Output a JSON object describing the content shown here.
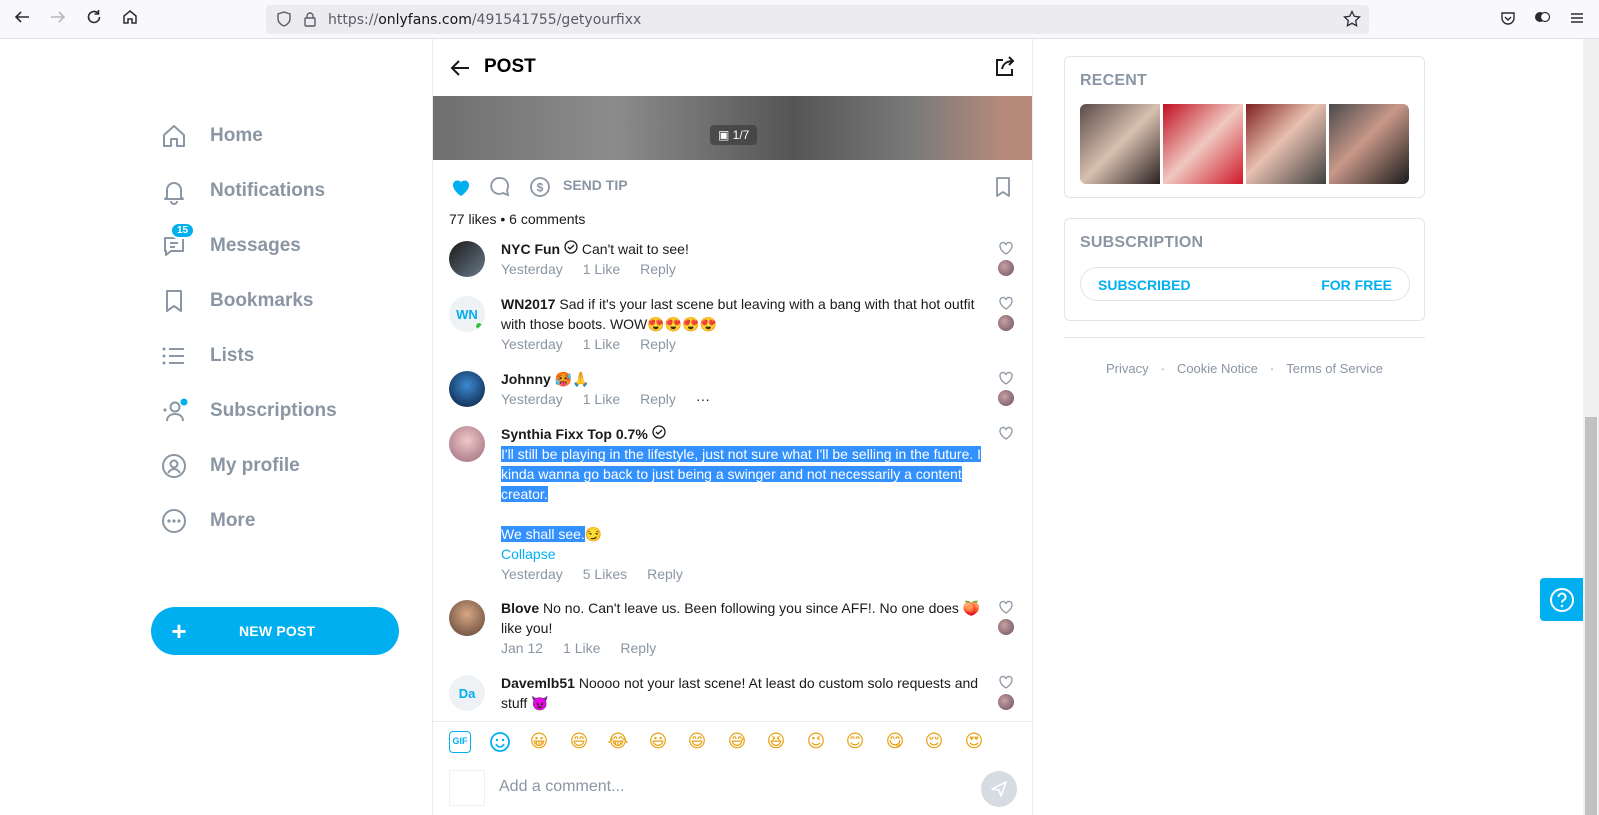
{
  "browser": {
    "url_prefix": "https://",
    "url_domain": "onlyfans.com",
    "url_path": "/491541755/getyourfixx"
  },
  "sidebar": {
    "items": [
      {
        "label": "Home",
        "icon": "home-icon"
      },
      {
        "label": "Notifications",
        "icon": "bell-icon"
      },
      {
        "label": "Messages",
        "icon": "message-icon",
        "badge": "15"
      },
      {
        "label": "Bookmarks",
        "icon": "bookmark-icon"
      },
      {
        "label": "Lists",
        "icon": "list-icon"
      },
      {
        "label": "Subscriptions",
        "icon": "subscriptions-icon"
      },
      {
        "label": "My profile",
        "icon": "profile-icon"
      },
      {
        "label": "More",
        "icon": "more-icon"
      }
    ],
    "new_post_label": "NEW POST"
  },
  "post": {
    "title": "POST",
    "image_counter": "1/7",
    "send_tip_label": "SEND TIP",
    "likes": "77 likes",
    "comments_count": "6 comments",
    "liked": true
  },
  "comments": [
    {
      "name": "NYC Fun",
      "text": "Can't wait to see!",
      "date": "Yesterday",
      "likes": "1 Like",
      "reply": "Reply",
      "avatar": ""
    },
    {
      "name": "WN2017",
      "text": "Sad if it's your last scene but leaving with a bang with that hot outfit with those boots. WOW😍😍😍😍",
      "date": "Yesterday",
      "likes": "1 Like",
      "reply": "Reply",
      "avatar": "WN"
    },
    {
      "name": "Johnny",
      "text": "🥵🙏",
      "date": "Yesterday",
      "likes": "1 Like",
      "reply": "Reply",
      "more": "···",
      "avatar": ""
    },
    {
      "name": "Synthia Fixx Top 0.7%",
      "text_line1": "I'll still be playing in the lifestyle, just not sure what I'll be selling in the future. I kinda wanna go back to just being a swinger and not necessarily a content creator.",
      "text_line2": "We shall see.",
      "emoji": "😏",
      "collapse": "Collapse",
      "date": "Yesterday",
      "likes": "5 Likes",
      "reply": "Reply",
      "avatar": ""
    },
    {
      "name": "Blove",
      "text": "No no. Can't leave us. Been following you since AFF!. No one does 🍑 like you!",
      "date": "Jan 12",
      "likes": "1 Like",
      "reply": "Reply",
      "avatar": ""
    },
    {
      "name": "Davemlb51",
      "text": "Noooo not your last scene! At least do custom solo requests and stuff 😈",
      "avatar": "Da"
    }
  ],
  "composer": {
    "placeholder": "Add a comment...",
    "gif_label": "GIF",
    "emojis": [
      "😀",
      "😄",
      "😂",
      "😃",
      "😄",
      "😅",
      "😆",
      "😉",
      "😊",
      "😋",
      "😌",
      "😍"
    ]
  },
  "right": {
    "recent_title": "RECENT",
    "subscription_title": "SUBSCRIPTION",
    "subscribed_label": "SUBSCRIBED",
    "price_label": "FOR FREE",
    "footer": [
      "Privacy",
      "Cookie Notice",
      "Terms of Service"
    ]
  },
  "colors": {
    "accent": "#00aff0",
    "muted": "#8a96a3",
    "selection": "#3390ff"
  }
}
